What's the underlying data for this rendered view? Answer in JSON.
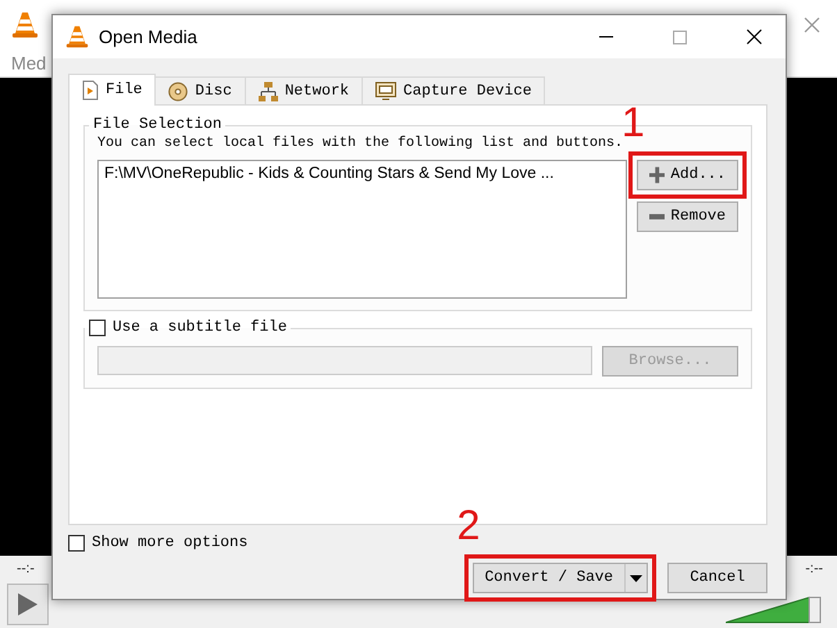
{
  "background_window": {
    "menu": "Med",
    "time_elapsed": "--:-",
    "time_total": "-:--"
  },
  "dialog": {
    "title": "Open Media"
  },
  "tabs": [
    {
      "label": "File",
      "selected": true
    },
    {
      "label": "Disc",
      "selected": false
    },
    {
      "label": "Network",
      "selected": false
    },
    {
      "label": "Capture Device",
      "selected": false
    }
  ],
  "file_selection": {
    "legend": "File Selection",
    "description": "You can select local files with the following list and buttons.",
    "files": [
      "F:\\MV\\OneRepublic - Kids & Counting Stars & Send My Love ..."
    ],
    "buttons": [
      {
        "label": "Add...",
        "highlighted": true,
        "callout": "1"
      },
      {
        "label": "Remove",
        "highlighted": false
      }
    ]
  },
  "subtitle": {
    "label": "Use a subtitle file",
    "checked": false,
    "browse": "Browse..."
  },
  "show_more_options": {
    "label": "Show more options",
    "checked": false
  },
  "actions": [
    {
      "label": "Convert / Save",
      "kind": "split",
      "highlighted": true,
      "callout": "2"
    },
    {
      "label": "Cancel",
      "kind": "plain",
      "highlighted": false
    }
  ]
}
